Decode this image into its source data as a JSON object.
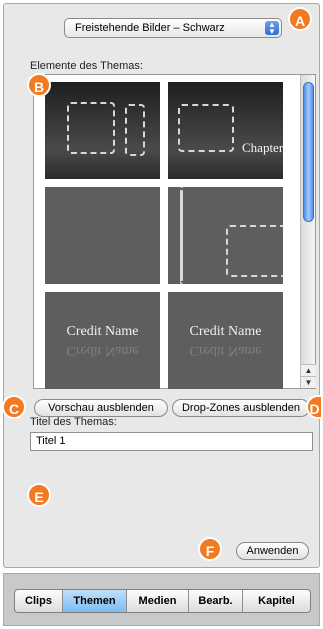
{
  "theme_selector": {
    "value": "Freistehende Bilder – Schwarz",
    "icon": "updown-arrows-icon"
  },
  "elements_label": "Elemente des Themas:",
  "thumbnails": {
    "chapter_text": "Chapter Ti",
    "credit_text_1": "Credit Name",
    "credit_text_2": "Credit Name"
  },
  "buttons": {
    "hide_preview": "Vorschau ausblenden",
    "hide_dropzones": "Drop-Zones ausblenden",
    "apply": "Anwenden"
  },
  "title_label": "Titel des Themas:",
  "title_input": {
    "value": "Titel 1"
  },
  "tabs": [
    {
      "label": "Clips"
    },
    {
      "label": "Themen",
      "active": true
    },
    {
      "label": "Medien"
    },
    {
      "label": "Bearb."
    },
    {
      "label": "Kapitel"
    }
  ],
  "callouts": {
    "a": "A",
    "b": "B",
    "c": "C",
    "d": "D",
    "e": "E",
    "f": "F"
  },
  "colors": {
    "callout": "#f37a20",
    "active_tab": "#8cc6f4",
    "scroll_thumb": "#4f8ee8"
  }
}
